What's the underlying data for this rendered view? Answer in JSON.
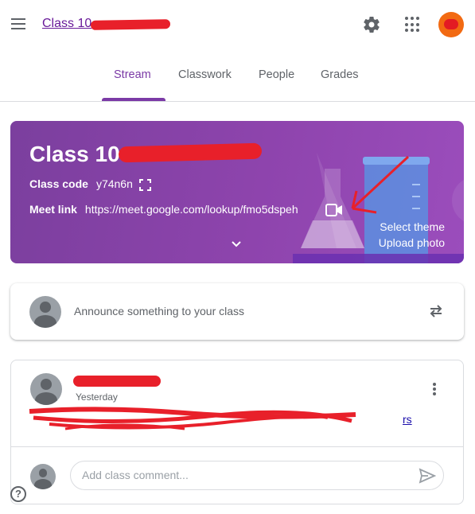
{
  "header": {
    "class_link": "Class 10",
    "avatar_color": "#f26a12"
  },
  "tabs": [
    {
      "label": "Stream",
      "active": true
    },
    {
      "label": "Classwork",
      "active": false
    },
    {
      "label": "People",
      "active": false
    },
    {
      "label": "Grades",
      "active": false
    }
  ],
  "banner": {
    "title": "Class 10",
    "class_code_label": "Class code",
    "class_code_value": "y74n6n",
    "meet_link_label": "Meet link",
    "meet_link_value": "https://meet.google.com/lookup/fmo5dspeh",
    "select_theme": "Select theme",
    "upload_photo": "Upload photo",
    "accent_color": "#8e44ad"
  },
  "announce": {
    "placeholder": "Announce something to your class"
  },
  "post": {
    "time": "Yesterday",
    "link_text_tail": "rs",
    "comment_placeholder": "Add class comment..."
  },
  "help": {
    "label": "?"
  },
  "icons": [
    "menu-icon",
    "gear-icon",
    "apps-icon",
    "fullscreen-icon",
    "video-camera-icon",
    "chevron-down-icon",
    "repost-icon",
    "more-vert-icon",
    "send-icon",
    "help-icon"
  ]
}
